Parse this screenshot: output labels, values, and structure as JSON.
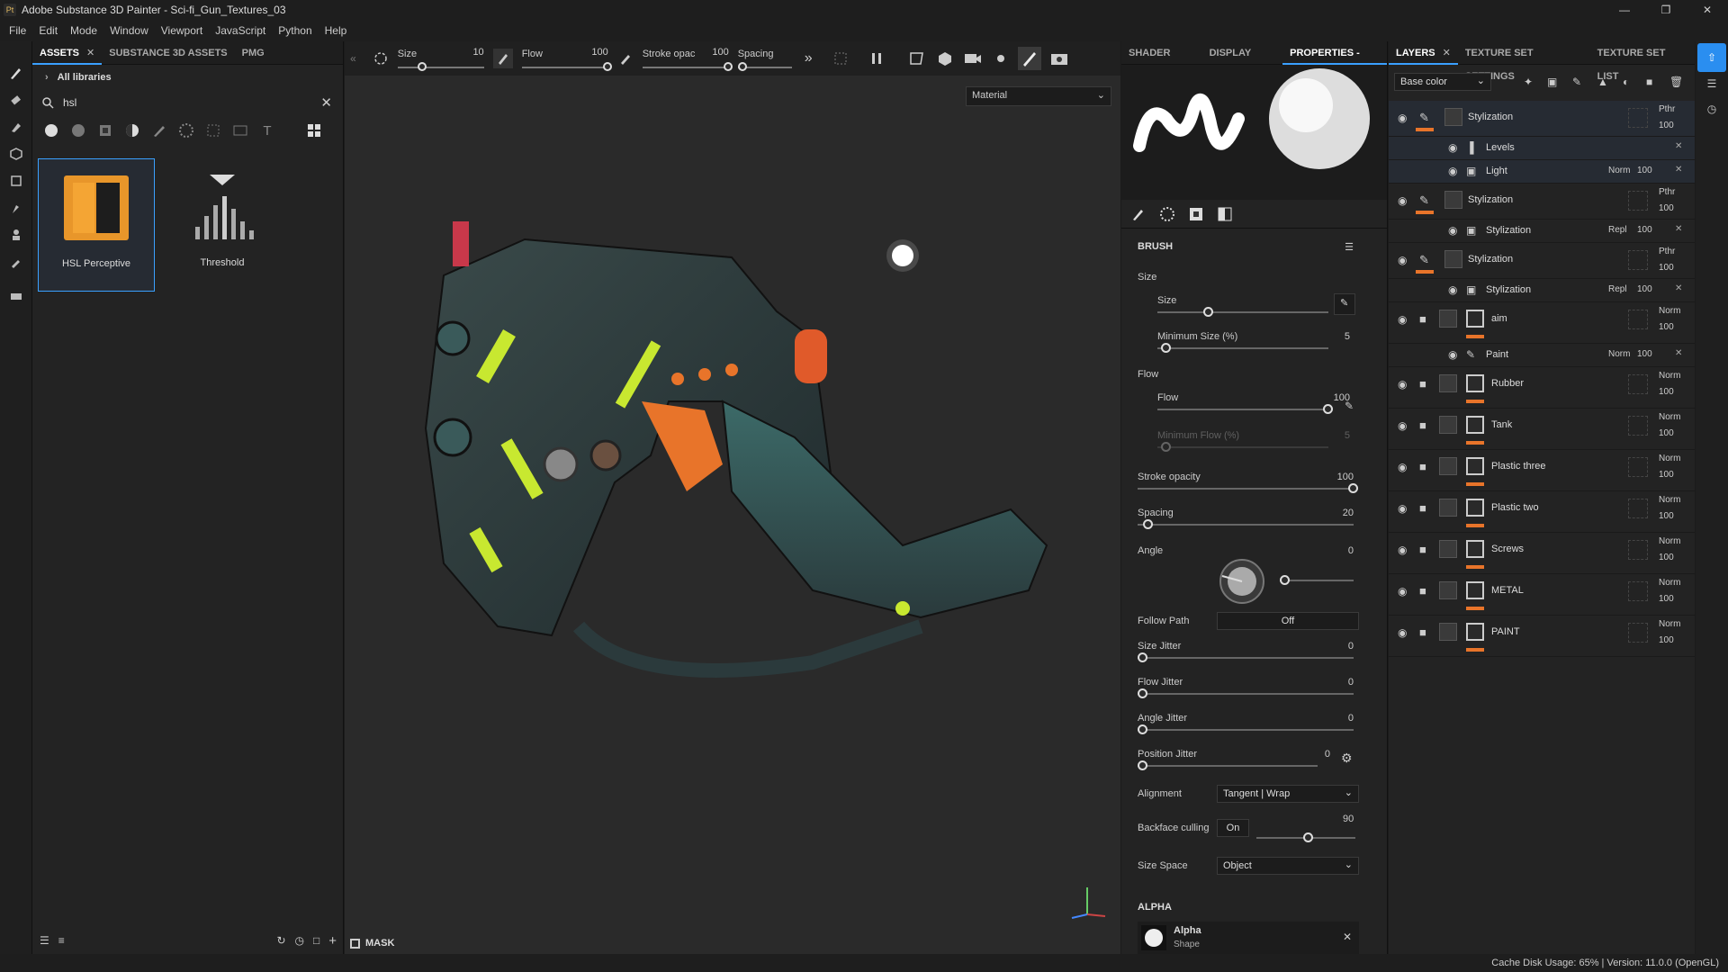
{
  "window": {
    "title": "Adobe Substance 3D Painter - Sci-fi_Gun_Textures_03",
    "logo": "Pt"
  },
  "menu": [
    "File",
    "Edit",
    "Mode",
    "Window",
    "Viewport",
    "JavaScript",
    "Python",
    "Help"
  ],
  "assets": {
    "tabs": [
      {
        "label": "ASSETS"
      },
      {
        "label": "SUBSTANCE 3D ASSETS"
      },
      {
        "label": "PMG"
      }
    ],
    "path": "All libraries",
    "search_value": "hsl",
    "items": [
      {
        "label": "HSL Perceptive"
      },
      {
        "label": "Threshold"
      }
    ]
  },
  "viewport": {
    "toolbar": [
      {
        "name": "Size",
        "value": "10",
        "fill": 0.3
      },
      {
        "name": "Flow",
        "value": "100",
        "fill": 1.0
      },
      {
        "name": "Stroke opac",
        "value": "100",
        "fill": 1.0
      },
      {
        "name": "Spacing",
        "value": "",
        "fill": 0.1
      }
    ],
    "material_mode": "Material",
    "mask_label": "MASK"
  },
  "properties": {
    "tabs": [
      "SHADER SET...",
      "DISPLAY SET...",
      "PROPERTIES - ..."
    ],
    "brush_title": "BRUSH",
    "size_group": "Size",
    "flow_group": "Flow",
    "size": {
      "label": "Size",
      "value": "10",
      "fill": 0.3
    },
    "min_size": {
      "label": "Minimum Size (%)",
      "value": "5",
      "fill": 0.05
    },
    "flow": {
      "label": "Flow",
      "value": "100",
      "fill": 1.0
    },
    "min_flow": {
      "label": "Minimum Flow (%)",
      "value": "5",
      "fill": 0.05
    },
    "stroke_opacity": {
      "label": "Stroke opacity",
      "value": "100",
      "fill": 1.0
    },
    "spacing": {
      "label": "Spacing",
      "value": "20",
      "fill": 0.05
    },
    "angle": {
      "label": "Angle",
      "value": "0"
    },
    "follow_path": {
      "label": "Follow Path",
      "value": "Off"
    },
    "size_jitter": {
      "label": "Size Jitter",
      "value": "0",
      "fill": 0
    },
    "flow_jitter": {
      "label": "Flow Jitter",
      "value": "0",
      "fill": 0
    },
    "angle_jitter": {
      "label": "Angle Jitter",
      "value": "0",
      "fill": 0
    },
    "position_jitter": {
      "label": "Position Jitter",
      "value": "0",
      "fill": 0
    },
    "alignment": {
      "label": "Alignment",
      "value": "Tangent | Wrap"
    },
    "backface": {
      "label": "Backface culling",
      "toggle": "On",
      "value": "90"
    },
    "size_space": {
      "label": "Size Space",
      "value": "Object"
    },
    "alpha_title": "ALPHA",
    "alpha_item": {
      "name": "Alpha",
      "sub": "Shape"
    }
  },
  "layers": {
    "tabs": [
      {
        "label": "LAYERS"
      },
      {
        "label": "TEXTURE SET SETTINGS"
      },
      {
        "label": "TEXTURE SET LIST"
      }
    ],
    "channel": "Base color",
    "rows": [
      {
        "name": "Stylization",
        "blend": "Pthr",
        "opacity": "100",
        "type": "paint"
      },
      {
        "name": "Levels",
        "blend": "",
        "opacity": "",
        "type": "sub-levels"
      },
      {
        "name": "Light",
        "blend": "Norm",
        "opacity": "100",
        "type": "sub"
      },
      {
        "name": "Stylization",
        "blend": "Pthr",
        "opacity": "100",
        "type": "paint"
      },
      {
        "name": "Stylization",
        "blend": "Repl",
        "opacity": "100",
        "type": "sub"
      },
      {
        "name": "Stylization",
        "blend": "Pthr",
        "opacity": "100",
        "type": "paint"
      },
      {
        "name": "Stylization",
        "blend": "Repl",
        "opacity": "100",
        "type": "sub"
      },
      {
        "name": "aim",
        "blend": "Norm",
        "opacity": "100",
        "type": "folder"
      },
      {
        "name": "Paint",
        "blend": "Norm",
        "opacity": "100",
        "type": "sub-paint"
      },
      {
        "name": "Rubber",
        "blend": "Norm",
        "opacity": "100",
        "type": "folder"
      },
      {
        "name": "Tank",
        "blend": "Norm",
        "opacity": "100",
        "type": "folder"
      },
      {
        "name": "Plastic three",
        "blend": "Norm",
        "opacity": "100",
        "type": "folder"
      },
      {
        "name": "Plastic two",
        "blend": "Norm",
        "opacity": "100",
        "type": "folder"
      },
      {
        "name": "Screws",
        "blend": "Norm",
        "opacity": "100",
        "type": "folder"
      },
      {
        "name": "METAL",
        "blend": "Norm",
        "opacity": "100",
        "type": "folder"
      },
      {
        "name": "PAINT",
        "blend": "Norm",
        "opacity": "100",
        "type": "folder"
      }
    ]
  },
  "status": "Cache Disk Usage:    65% | Version: 11.0.0 (OpenGL)",
  "colors": {
    "accent": "#3aa0ff",
    "orange": "#e8742a",
    "lime": "#c8e830"
  }
}
